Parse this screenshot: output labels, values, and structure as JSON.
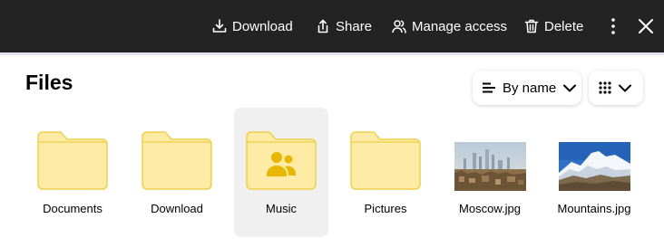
{
  "toolbar": {
    "download_label": "Download",
    "share_label": "Share",
    "manage_access_label": "Manage access",
    "delete_label": "Delete",
    "more_icon": "more-vertical-icon",
    "close_icon": "close-icon"
  },
  "page": {
    "title": "Files"
  },
  "controls": {
    "sort_label": "By name",
    "sort_icon": "sort-lines-icon",
    "view_icon": "grid-view-icon"
  },
  "items": [
    {
      "name": "Documents",
      "type": "folder"
    },
    {
      "name": "Download",
      "type": "folder"
    },
    {
      "name": "Music",
      "type": "shared-folder",
      "selected": true
    },
    {
      "name": "Pictures",
      "type": "folder"
    },
    {
      "name": "Moscow.jpg",
      "type": "image"
    },
    {
      "name": "Mountains.jpg",
      "type": "image"
    }
  ],
  "colors": {
    "toolbar_bg": "#232323",
    "folder_fill": "#fdeba6",
    "folder_stroke": "#f0d04a",
    "shared_icon": "#e8b800",
    "selected_bg": "#f0f0f0"
  }
}
